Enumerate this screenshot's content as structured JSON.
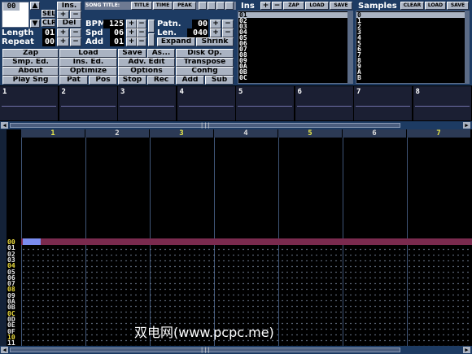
{
  "instrument_panel": {
    "instrument_number": "00",
    "ins_label": "Ins.",
    "sel_label": "SEL",
    "clr_label": "CLR",
    "del_label": "Del",
    "plus": "+",
    "minus": "−"
  },
  "song": {
    "song_title_label": "SONG TITLE:",
    "title_label": "TITLE",
    "time_label": "TIME",
    "peak_label": "PEAK",
    "length_label": "Length",
    "length_value": "01",
    "repeat_label": "Repeat",
    "repeat_value": "00",
    "bpm_label": "BPM",
    "bpm_value": "125",
    "spd_label": "Spd",
    "spd_value": "06",
    "add_label": "Add",
    "add_value": "01",
    "patn_label": "Patn.",
    "patn_value": "00",
    "len_label": "Len.",
    "len_value": "040",
    "expand_label": "Expand",
    "shrink_label": "Shrink"
  },
  "main_buttons": [
    [
      "Zap",
      "Load",
      "Save",
      "As...",
      "Disk Op."
    ],
    [
      "Smp. Ed.",
      "Ins. Ed.",
      "Adv. Edit",
      "Transpose"
    ],
    [
      "About",
      "Optimize",
      "Options",
      "Config"
    ],
    [
      "Play Sng",
      "Pat",
      "Pos",
      "Stop",
      "Rec",
      "Add",
      "Sub"
    ]
  ],
  "ins_list": {
    "header": "Ins",
    "zap": "ZAP",
    "load": "LOAD",
    "save": "SAVE",
    "items": [
      "01",
      "02",
      "03",
      "04",
      "05",
      "06",
      "07",
      "08",
      "09",
      "0A",
      "0B",
      "0C"
    ]
  },
  "samples_list": {
    "header": "Samples",
    "clear": "CLEAR",
    "load": "LOAD",
    "save": "SAVE",
    "items": [
      "0",
      "1",
      "2",
      "3",
      "4",
      "5",
      "6",
      "7",
      "8",
      "9",
      "A",
      "B"
    ]
  },
  "scopes": [
    "1",
    "2",
    "3",
    "4",
    "5",
    "6",
    "7",
    "8"
  ],
  "channels": [
    "1",
    "2",
    "3",
    "4",
    "5",
    "6",
    "7"
  ],
  "rows": [
    "00",
    "01",
    "02",
    "03",
    "04",
    "05",
    "06",
    "07",
    "08",
    "09",
    "0A",
    "0B",
    "0C",
    "0D",
    "0E",
    "0F",
    "10",
    "11"
  ],
  "watermark": "双电网(www.pcpc.me)",
  "colors": {
    "panel": "#1d3b63",
    "button": "#aab3c2",
    "highlight_row": "#7a2a4e",
    "cursor": "#7a8cf0",
    "row_highlight_number": "#f0e040"
  }
}
